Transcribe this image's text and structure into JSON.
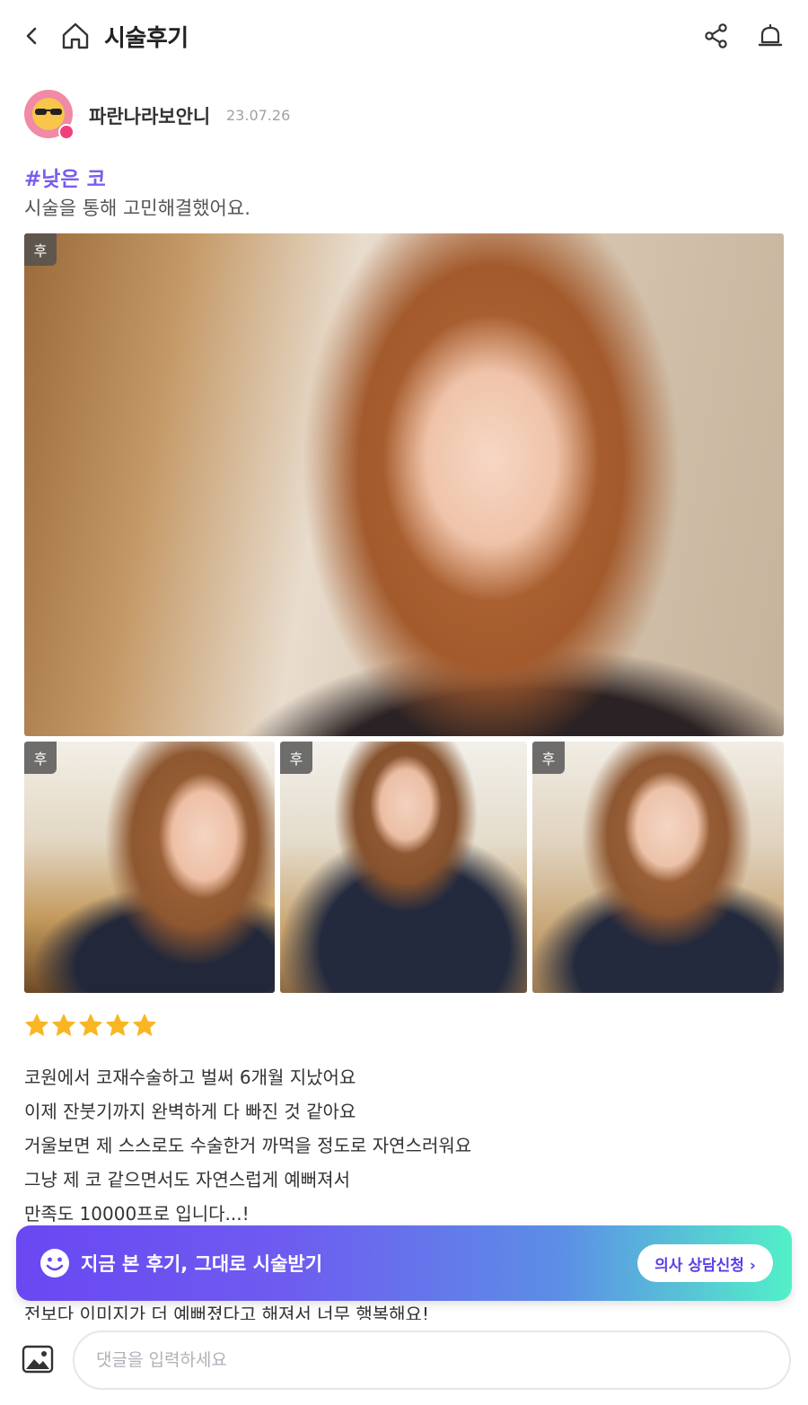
{
  "header": {
    "title": "시술후기",
    "back_icon": "chevron-left-icon",
    "home_icon": "home-icon",
    "share_icon": "share-icon",
    "alert_icon": "bell-icon"
  },
  "author": {
    "name": "파란나라보안니",
    "date": "23.07.26",
    "avatar_icon": "sunglasses-emoji-icon"
  },
  "post": {
    "hashtag": "#낮은 코",
    "summary": "시술을 통해 고민해결했어요.",
    "photos": [
      {
        "tag": "후"
      },
      {
        "tag": "후"
      },
      {
        "tag": "후"
      },
      {
        "tag": "후"
      }
    ],
    "rating": 5,
    "review_lines": [
      "코원에서 코재수술하고 벌써 6개월 지났어요",
      "이제 잔붓기까지 완벽하게 다 빠진 것 같아요",
      "거울보면 제 스스로도 수술한거 까먹을 정도로 자연스러워요",
      "그냥 제 코 같으면서도 자연스럽게 예뻐져서",
      "만족도 10000프로 입니다...!"
    ],
    "review_partial": "전보다 이미지가 더 예뻐졌다고 해져서 너무 행복해요!"
  },
  "cta": {
    "text": "지금 본 후기, 그대로 시술받기",
    "button": "의사 상담신청 ›",
    "icon": "smile-icon"
  },
  "comment": {
    "placeholder": "댓글을 입력하세요",
    "image_icon": "image-icon"
  },
  "colors": {
    "accent": "#7b5cf0",
    "star": "#f8b624",
    "cta_start": "#6a47f2",
    "cta_end": "#52f0c8"
  }
}
